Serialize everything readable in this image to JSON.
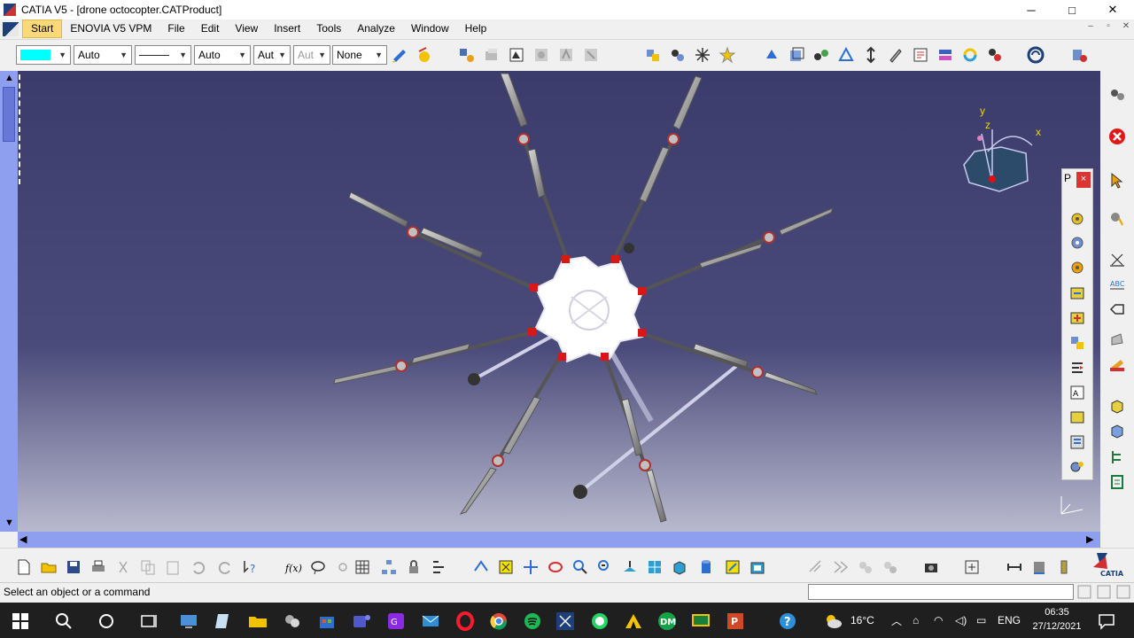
{
  "window": {
    "title": "CATIA V5 - [drone octocopter.CATProduct]",
    "minimize": "─",
    "maximize": "□",
    "close": "✕"
  },
  "menu": {
    "items": [
      {
        "label": "Start"
      },
      {
        "label": "ENOVIA V5 VPM"
      },
      {
        "label": "File"
      },
      {
        "label": "Edit"
      },
      {
        "label": "View"
      },
      {
        "label": "Insert"
      },
      {
        "label": "Tools"
      },
      {
        "label": "Analyze"
      },
      {
        "label": "Window"
      },
      {
        "label": "Help"
      }
    ],
    "mdi": {
      "minimize": "–",
      "restore": "▫",
      "close": "✕"
    }
  },
  "graphic_props": {
    "fill_color": "#00ffff",
    "transparency": "Auto",
    "line_weight": "────",
    "line_type": "Auto",
    "thickness": "Aut",
    "layer_disabled": "Aut",
    "layer": "None"
  },
  "compass": {
    "x": "x",
    "y": "y",
    "z": "z"
  },
  "float_panel": {
    "header": "P",
    "close": "×"
  },
  "status": {
    "message": "Select an object or a command"
  },
  "taskbar": {
    "weather": "16°C",
    "language": "ENG",
    "time": "06:35",
    "date": "27/12/2021"
  },
  "colors": {
    "viewport_top": "#3b3c6b",
    "scrollbar": "#8f9ff0",
    "highlight": "#f9d97a"
  }
}
